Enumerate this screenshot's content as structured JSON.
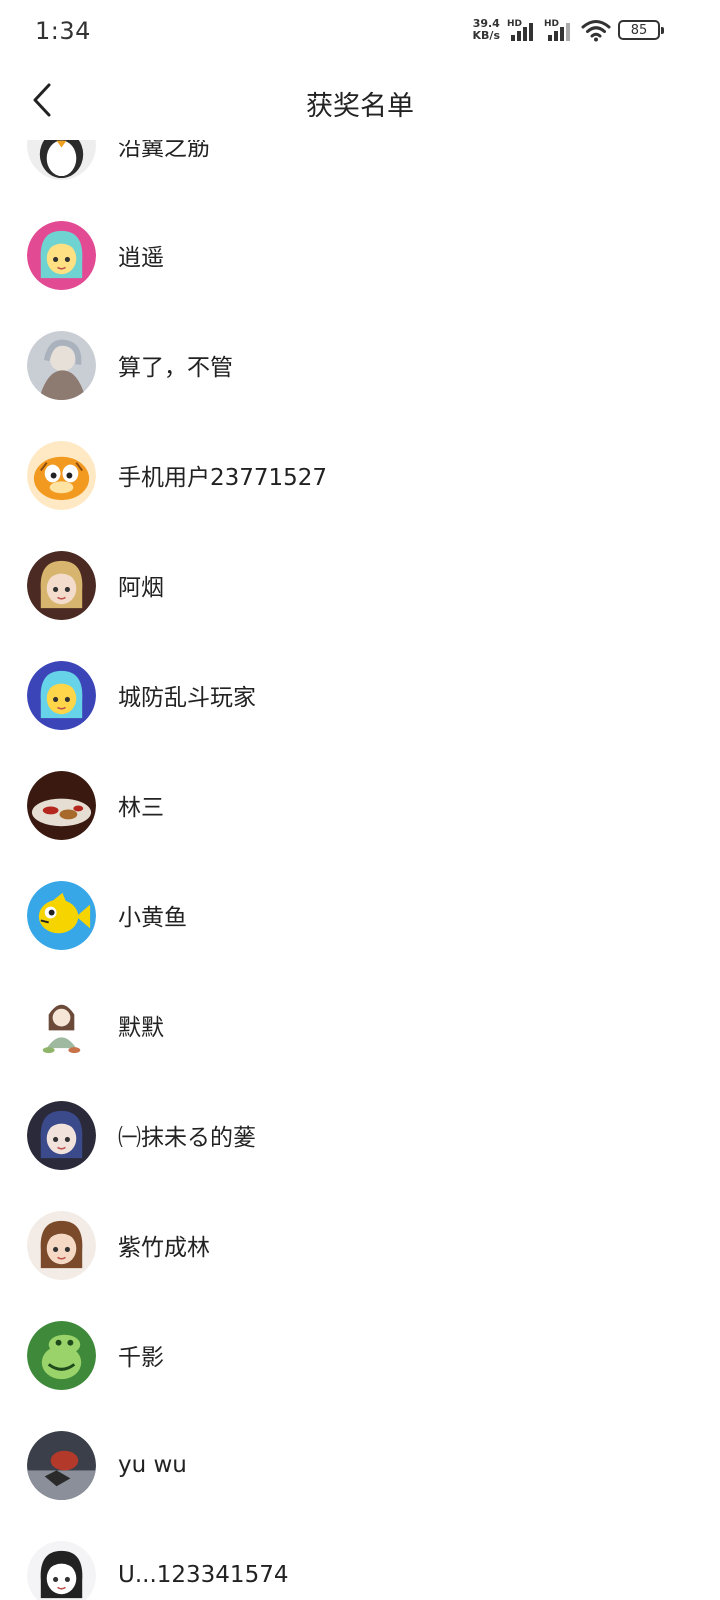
{
  "status_bar": {
    "time": "1:34",
    "net_speed_value": "39.4",
    "net_speed_unit": "KB/s",
    "sim1_label": "HD",
    "sim2_label": "HD",
    "battery": "85"
  },
  "header": {
    "title": "获奖名单"
  },
  "winners": [
    {
      "name": "沿冀之筋",
      "avatar": {
        "icon": "penguin-avatar",
        "bg": "#eeeeee",
        "fg": "#ffffff",
        "accent": "#f0a020"
      }
    },
    {
      "name": "逍遥",
      "avatar": {
        "icon": "anime-girl-avatar",
        "bg": "#e24a93",
        "fg": "#ffe082",
        "accent": "#6ed3d1"
      }
    },
    {
      "name": "算了，不管",
      "avatar": {
        "icon": "photo-avatar",
        "bg": "#c9cdd4",
        "fg": "#8d7a70",
        "accent": "#e7e0d8"
      }
    },
    {
      "name": "手机用户23771527",
      "avatar": {
        "icon": "garfield-avatar",
        "bg": "#ffe9c4",
        "fg": "#f29a1f",
        "accent": "#ffffff"
      }
    },
    {
      "name": "阿烟",
      "avatar": {
        "icon": "anime-girl-avatar",
        "bg": "#4a2a22",
        "fg": "#f3dccb",
        "accent": "#d7b56e"
      }
    },
    {
      "name": "城防乱斗玩家",
      "avatar": {
        "icon": "anime-girl-avatar",
        "bg": "#3b45b8",
        "fg": "#ffd54a",
        "accent": "#66d3e8"
      }
    },
    {
      "name": "林三",
      "avatar": {
        "icon": "food-photo-avatar",
        "bg": "#3a1a10",
        "fg": "#e6ded2",
        "accent": "#b3271e"
      }
    },
    {
      "name": "小黄鱼",
      "avatar": {
        "icon": "fish-avatar",
        "bg": "#38a7e8",
        "fg": "#f5d400",
        "accent": "#222222"
      }
    },
    {
      "name": "默默",
      "avatar": {
        "icon": "sketch-girl-avatar",
        "bg": "#ffffff",
        "fg": "#9fb9a0",
        "accent": "#6b4a3a"
      }
    },
    {
      "name": "㈠抹未る的蓌",
      "avatar": {
        "icon": "anime-girl-avatar",
        "bg": "#2a2a3a",
        "fg": "#f2e2dc",
        "accent": "#3a4a8a"
      }
    },
    {
      "name": "紫竹成林",
      "avatar": {
        "icon": "anime-girl-avatar",
        "bg": "#f3ece6",
        "fg": "#f5d9c4",
        "accent": "#7a4a2a"
      }
    },
    {
      "name": "千影",
      "avatar": {
        "icon": "dragon-avatar",
        "bg": "#3f8a3a",
        "fg": "#9ad36a",
        "accent": "#1f4a1c"
      }
    },
    {
      "name": "yu wu",
      "avatar": {
        "icon": "figure-photo-avatar",
        "bg": "#3a3f4a",
        "fg": "#b33a2a",
        "accent": "#8a8f9a"
      }
    },
    {
      "name": "U...123341574",
      "avatar": {
        "icon": "anime-girl-avatar",
        "bg": "#f4f4f6",
        "fg": "#ffffff",
        "accent": "#222222"
      }
    }
  ]
}
